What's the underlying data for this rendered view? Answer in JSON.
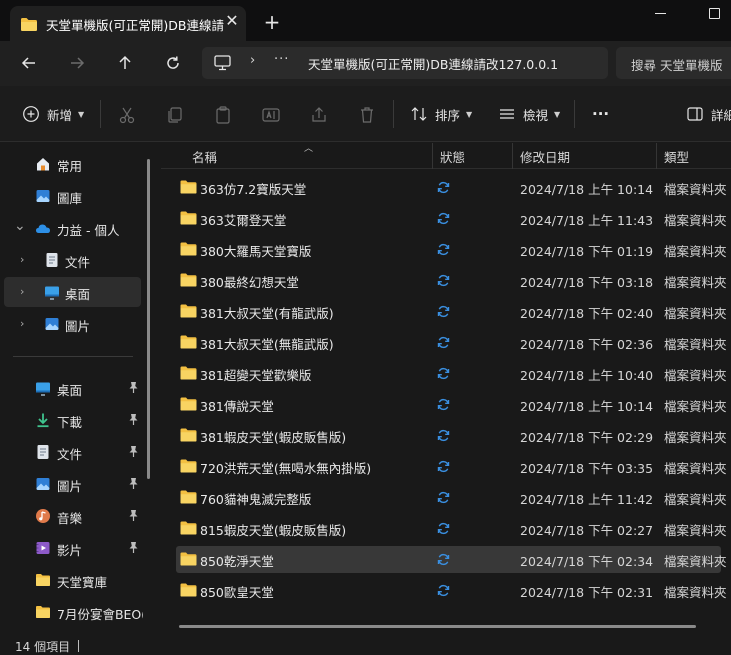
{
  "window": {
    "tab_title": "天堂單機版(可正常開)DB連線請",
    "close_glyph": "✕",
    "newtab_glyph": "+"
  },
  "nav": {
    "address_path": "天堂單機版(可正常開)DB連線請改127.0.0.1",
    "address_chevron": "›",
    "address_more": "···",
    "search_placeholder": "搜尋 天堂單機版"
  },
  "toolbar": {
    "new_label": "新增",
    "sort_label": "排序",
    "view_label": "檢視",
    "more_label": "···",
    "details_label": "詳細"
  },
  "sidebar": {
    "top": [
      {
        "label": "常用",
        "icon": "home-icon"
      },
      {
        "label": "圖庫",
        "icon": "gallery-icon"
      },
      {
        "label": "力益 - 個人",
        "icon": "onedrive-icon",
        "expander": "⌄"
      },
      {
        "label": "文件",
        "icon": "documents-icon",
        "expander": "›"
      },
      {
        "label": "桌面",
        "icon": "desktop-icon",
        "expander": "›"
      },
      {
        "label": "圖片",
        "icon": "pictures-icon",
        "expander": "›"
      }
    ],
    "quick_access": [
      {
        "label": "桌面",
        "icon": "desktop-icon",
        "pinned": true
      },
      {
        "label": "下載",
        "icon": "download-icon",
        "pinned": true
      },
      {
        "label": "文件",
        "icon": "documents-icon",
        "pinned": true
      },
      {
        "label": "圖片",
        "icon": "pictures-icon",
        "pinned": true
      },
      {
        "label": "音樂",
        "icon": "music-icon",
        "pinned": true
      },
      {
        "label": "影片",
        "icon": "videos-icon",
        "pinned": true
      },
      {
        "label": "天堂寶庫",
        "icon": "folder-icon",
        "pinned": false
      },
      {
        "label": "7月份宴會BEO(",
        "icon": "folder-icon",
        "pinned": false
      }
    ]
  },
  "columns": {
    "name": "名稱",
    "status": "狀態",
    "modified": "修改日期",
    "type": "類型"
  },
  "files": [
    {
      "name": "363仿7.2寶版天堂",
      "date": "2024/7/18 上午 10:14",
      "type": "檔案資料夾"
    },
    {
      "name": "363艾爾登天堂",
      "date": "2024/7/18 上午 11:43",
      "type": "檔案資料夾"
    },
    {
      "name": "380大羅馬天堂寶版",
      "date": "2024/7/18 下午 01:19",
      "type": "檔案資料夾"
    },
    {
      "name": "380最終幻想天堂",
      "date": "2024/7/18 下午 03:18",
      "type": "檔案資料夾"
    },
    {
      "name": "381大叔天堂(有龍武版)",
      "date": "2024/7/18 下午 02:40",
      "type": "檔案資料夾"
    },
    {
      "name": "381大叔天堂(無龍武版)",
      "date": "2024/7/18 下午 02:36",
      "type": "檔案資料夾"
    },
    {
      "name": "381超變天堂歡樂版",
      "date": "2024/7/18 上午 10:40",
      "type": "檔案資料夾"
    },
    {
      "name": "381傳說天堂",
      "date": "2024/7/18 上午 10:14",
      "type": "檔案資料夾"
    },
    {
      "name": "381蝦皮天堂(蝦皮販售版)",
      "date": "2024/7/18 下午 02:29",
      "type": "檔案資料夾"
    },
    {
      "name": "720洪荒天堂(無喝水無內掛版)",
      "date": "2024/7/18 下午 03:35",
      "type": "檔案資料夾"
    },
    {
      "name": "760貓神鬼滅完整版",
      "date": "2024/7/18 上午 11:42",
      "type": "檔案資料夾"
    },
    {
      "name": "815蝦皮天堂(蝦皮販售版)",
      "date": "2024/7/18 下午 02:27",
      "type": "檔案資料夾"
    },
    {
      "name": "850乾淨天堂",
      "date": "2024/7/18 下午 02:34",
      "type": "檔案資料夾",
      "selected": true
    },
    {
      "name": "850歐皇天堂",
      "date": "2024/7/18 下午 02:31",
      "type": "檔案資料夾"
    }
  ],
  "statusbar": {
    "count": "14 個項目"
  },
  "colors": {
    "folder": "#f3c042",
    "sync": "#3a8fe0",
    "accent": "#4cc2ff"
  }
}
